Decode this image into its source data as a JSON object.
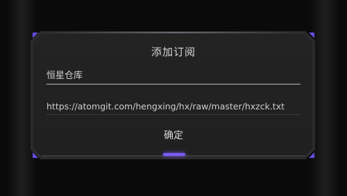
{
  "dialog": {
    "title": "添加订阅",
    "name_value": "恒星仓库",
    "url_value": "https://atomgit.com/hengxing/hx/raw/master/hxzck.txt",
    "confirm_label": "确定"
  },
  "colors": {
    "accent": "#7a5cff",
    "dialog_bg": "#222222",
    "text": "#d8d8d8"
  }
}
